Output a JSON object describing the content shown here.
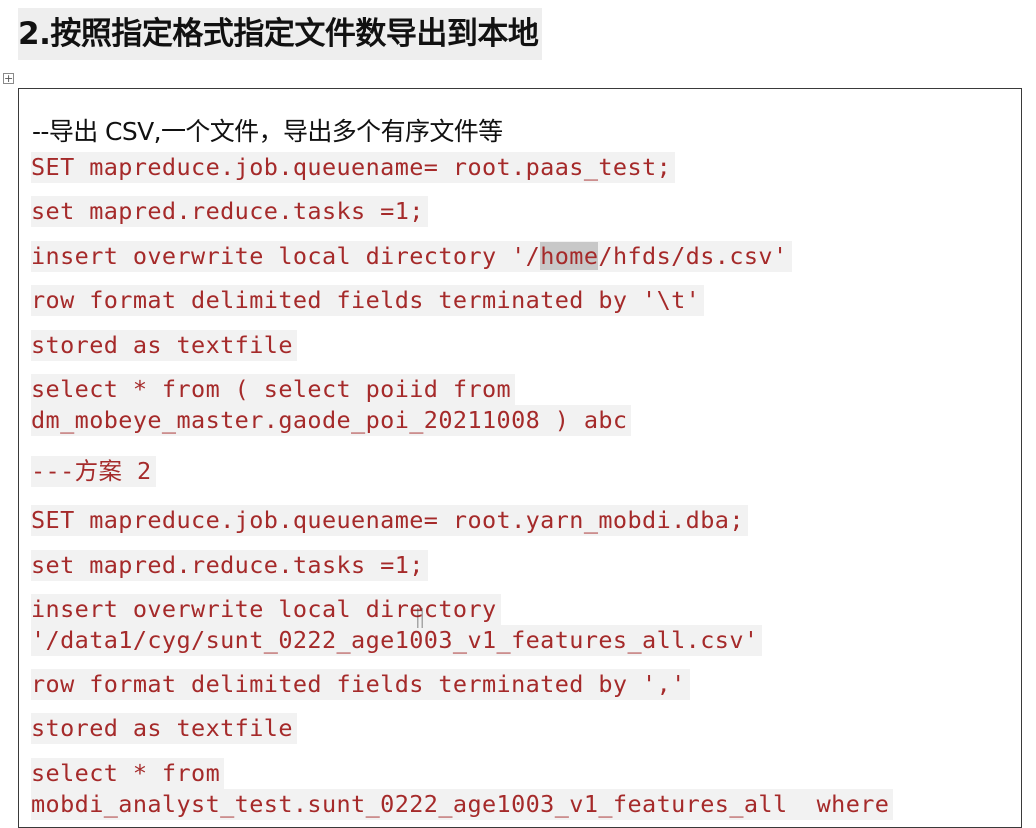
{
  "heading": "2.按照指定格式指定文件数导出到本地",
  "comment": "--导出 CSV,一个文件，导出多个有序文件等",
  "anchor_icon": "move-handle-icon",
  "code": {
    "l1": "SET mapreduce.job.queuename= root.paas_test;",
    "l2": "set mapred.reduce.tasks =1;",
    "l3_pre": "insert overwrite local directory '/",
    "l3_hl": "home",
    "l3_post": "/hfds/ds.csv'",
    "l4": "row format delimited fields terminated by '\\t'",
    "l5": "stored as textfile",
    "l6a": "select * from ( select poiid from",
    "l6b": "dm_mobeye_master.gaode_poi_20211008 ) abc",
    "l7": "---方案 2",
    "l8": "SET mapreduce.job.queuename= root.yarn_mobdi.dba;",
    "l9": "set mapred.reduce.tasks =1;",
    "l10a": "insert overwrite local directory",
    "l10b": "'/data1/cyg/sunt_0222_age1003_v1_features_all.csv'",
    "l11": "row format delimited fields terminated by ','",
    "l12": "stored as textfile",
    "l13a": "select * from",
    "l13b": "mobdi_analyst_test.sunt_0222_age1003_v1_features_all  where"
  }
}
